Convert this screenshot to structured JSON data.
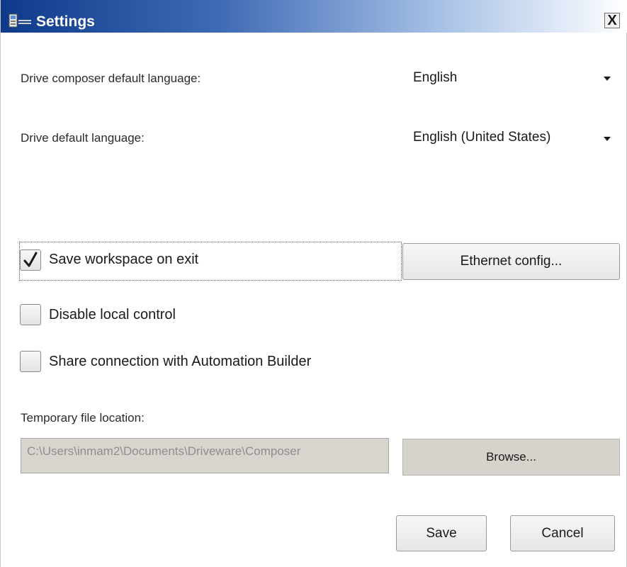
{
  "window": {
    "title": "Settings",
    "close_glyph": "X"
  },
  "language": {
    "composer_label": "Drive composer default language:",
    "composer_value": "English",
    "drive_label": "Drive default language:",
    "drive_value": "English (United States)"
  },
  "options": {
    "save_workspace": {
      "label": "Save workspace on exit",
      "checked": true
    },
    "disable_local_control": {
      "label": "Disable local control",
      "checked": false
    },
    "share_connection": {
      "label": "Share connection with Automation Builder",
      "checked": false
    },
    "ethernet_button": "Ethernet config..."
  },
  "temp": {
    "label": "Temporary file location:",
    "path": "C:\\Users\\inmam2\\Documents\\Driveware\\Composer",
    "browse_button": "Browse..."
  },
  "footer": {
    "save_button": "Save",
    "cancel_button": "Cancel"
  },
  "icons": {
    "app": "app-icon",
    "close": "close-icon",
    "dropdown": "chevron-down-icon",
    "check": "checkmark-icon"
  },
  "colors": {
    "titlebar_start": "#0f3a8a",
    "titlebar_end": "#ffffff",
    "disabled_field": "#d8d5ce"
  }
}
